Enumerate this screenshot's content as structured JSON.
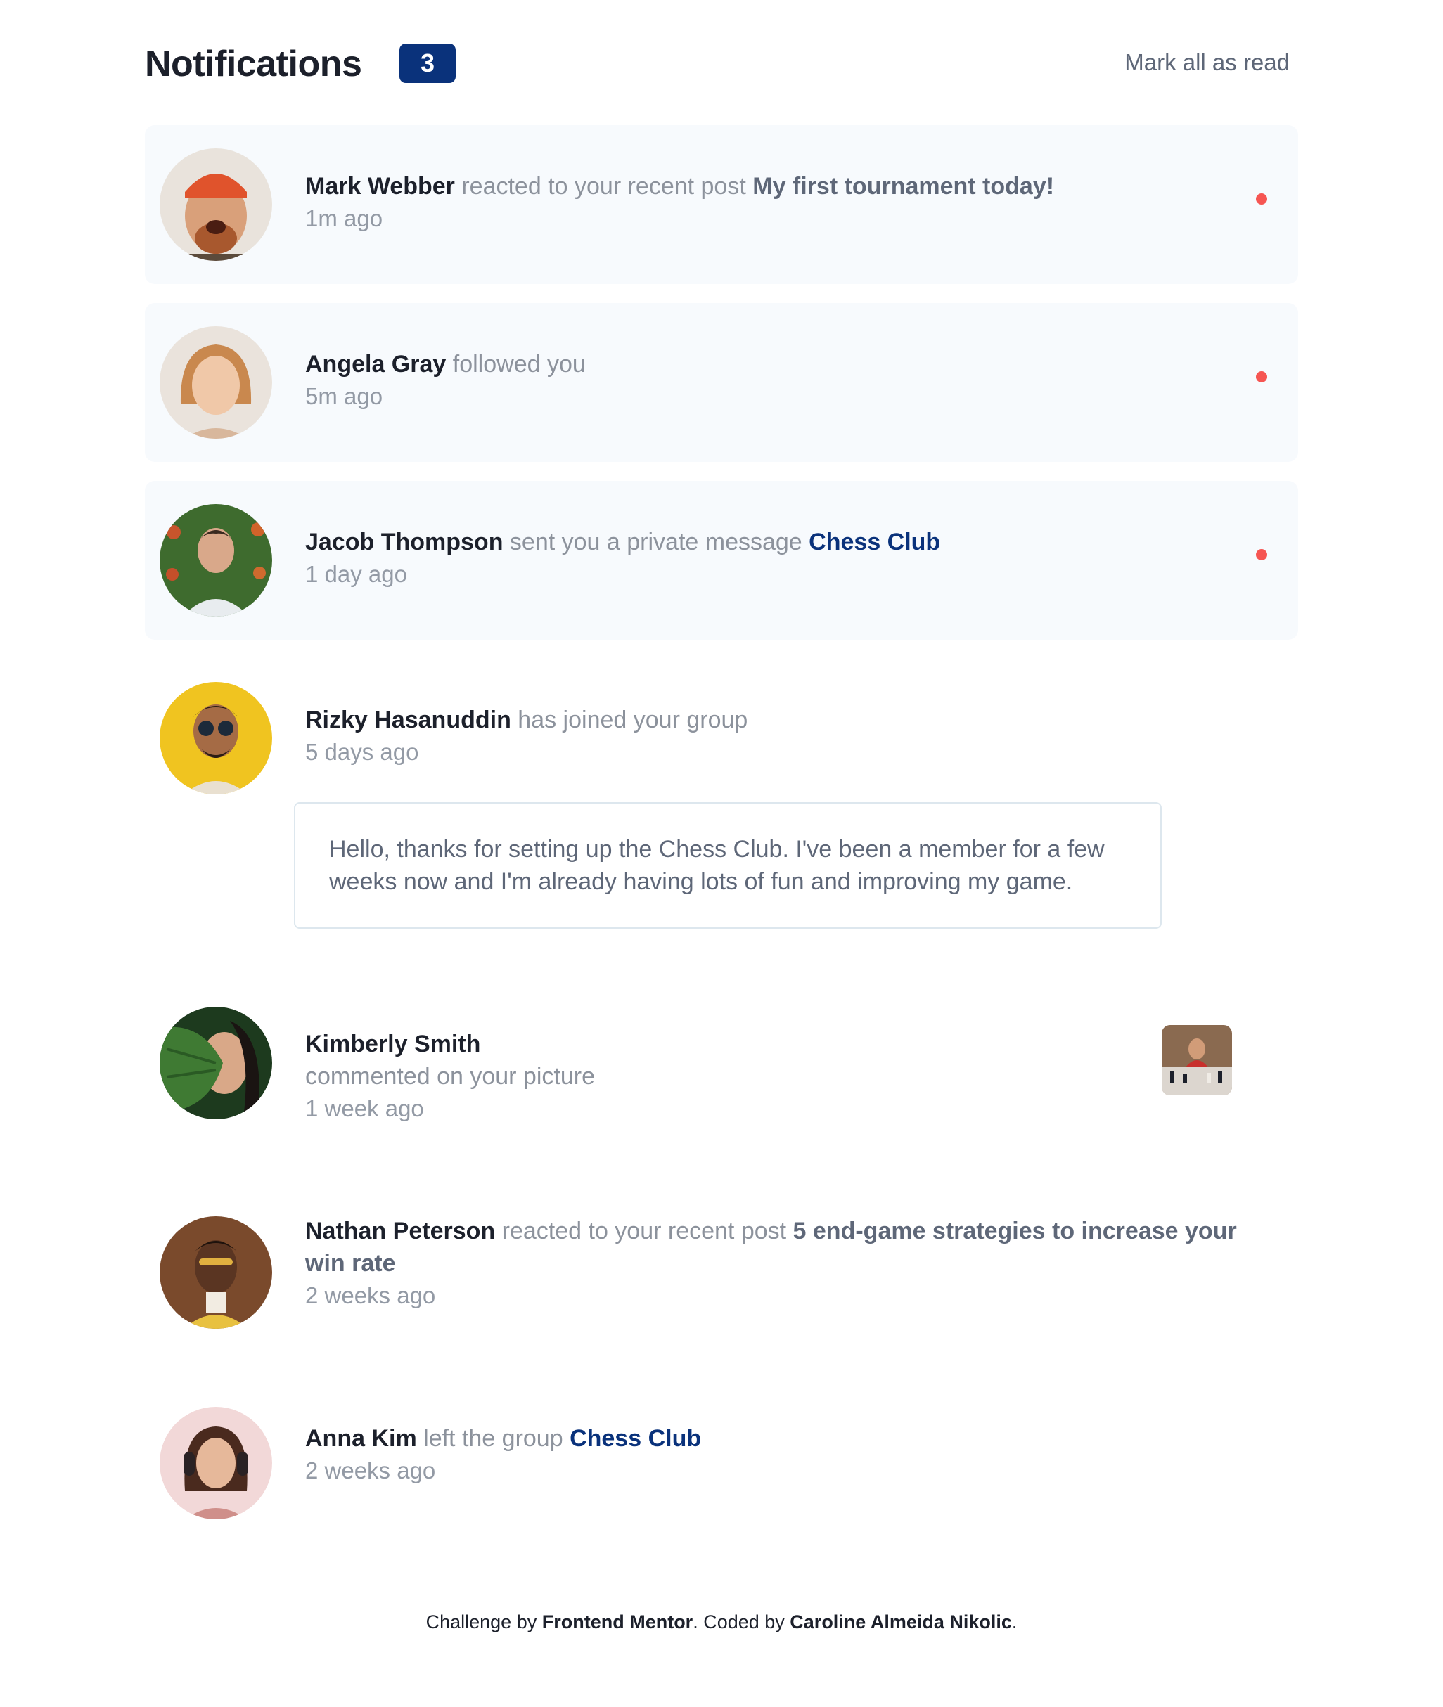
{
  "header": {
    "title": "Notifications",
    "unread_count": "3",
    "mark_all_label": "Mark all as read"
  },
  "notifications": [
    {
      "actor": "Mark Webber",
      "action": "reacted to your recent post",
      "object": "My first tournament today!",
      "time": "1m ago",
      "unread": true
    },
    {
      "actor": "Angela Gray",
      "action": "followed you",
      "time": "5m ago",
      "unread": true
    },
    {
      "actor": "Jacob Thompson",
      "action": "sent you a private message",
      "group": "Chess Club",
      "time": "1 day ago",
      "unread": true
    },
    {
      "actor": "Rizky Hasanuddin",
      "action": "has joined your group",
      "time": "5 days ago",
      "unread": false,
      "message": "Hello, thanks for setting up the Chess Club. I've been a member for a few weeks now and I'm already having lots of fun and improving my game."
    },
    {
      "actor": "Kimberly Smith",
      "action": "commented on your picture",
      "time": "1 week ago",
      "unread": false
    },
    {
      "actor": "Nathan Peterson",
      "action": "reacted to your recent post",
      "object_line1": "5 end-game strategies to increase your",
      "object_line2": "win rate",
      "time": "2 weeks ago",
      "unread": false
    },
    {
      "actor": "Anna Kim",
      "action": "left the group",
      "group": "Chess Club",
      "time": "2 weeks ago",
      "unread": false
    }
  ],
  "footer": {
    "prefix": "Challenge by ",
    "challenge_by": "Frontend Mentor",
    "middle": ". Coded by ",
    "coded_by": "Caroline Almeida Nikolic",
    "suffix": "."
  },
  "colors": {
    "accent": "#0a327b",
    "unread_dot": "#f65552",
    "unread_bg": "#f7fafd",
    "text_dark": "#1c202b",
    "text_muted": "#8c929c"
  }
}
